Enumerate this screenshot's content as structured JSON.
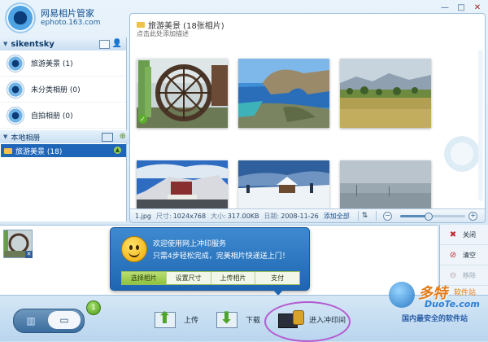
{
  "app": {
    "name": "网易相片管家",
    "domain": "ephoto.163.com"
  },
  "window": {
    "minimize_label": "—",
    "maximize_label": "□",
    "close_label": "✕"
  },
  "account": {
    "username": "sikentsky",
    "albums": [
      {
        "label": "旅游美景 (1)"
      },
      {
        "label": "未分类相册 (0)"
      },
      {
        "label": "自拍相册 (0)"
      }
    ]
  },
  "local": {
    "header": "本地相册",
    "selected_item": "旅游美景 (18)"
  },
  "main": {
    "title": "旅游美景 (18张相片)",
    "description": "点击此处添加描述"
  },
  "status": {
    "filename": "1.jpg",
    "size_label": "尺寸:",
    "size_value": "1024x768",
    "filesize_label": "大小:",
    "filesize_value": "317.00KB",
    "date_label": "日期:",
    "date_value": "2008-11-26",
    "add_all": "添加全部",
    "zoom_level": 0.42
  },
  "side_actions": [
    {
      "label": "关闭",
      "icon": "close-x-icon"
    },
    {
      "label": "清空",
      "icon": "clear-icon"
    },
    {
      "label": "移除",
      "icon": "remove-icon"
    }
  ],
  "popup": {
    "title": "欢迎使用网上冲印服务",
    "subtitle": "只需4步轻松完成，完美相片快递送上门！",
    "steps": [
      "选择相片",
      "设置尺寸",
      "上传相片",
      "支付"
    ],
    "active_step": 0
  },
  "toolbar": {
    "badge_count": "1",
    "upload_label": "上传",
    "download_label": "下载",
    "print_label": "进入冲印间"
  },
  "brand": {
    "name": "多特",
    "name_suffix": "软件站",
    "site": "DuoTe.com",
    "slogan": "国内最安全的软件站"
  },
  "colors": {
    "accent": "#1f66b8",
    "highlight_ring": "#b45ad0",
    "step_active": "#8fc23f"
  }
}
